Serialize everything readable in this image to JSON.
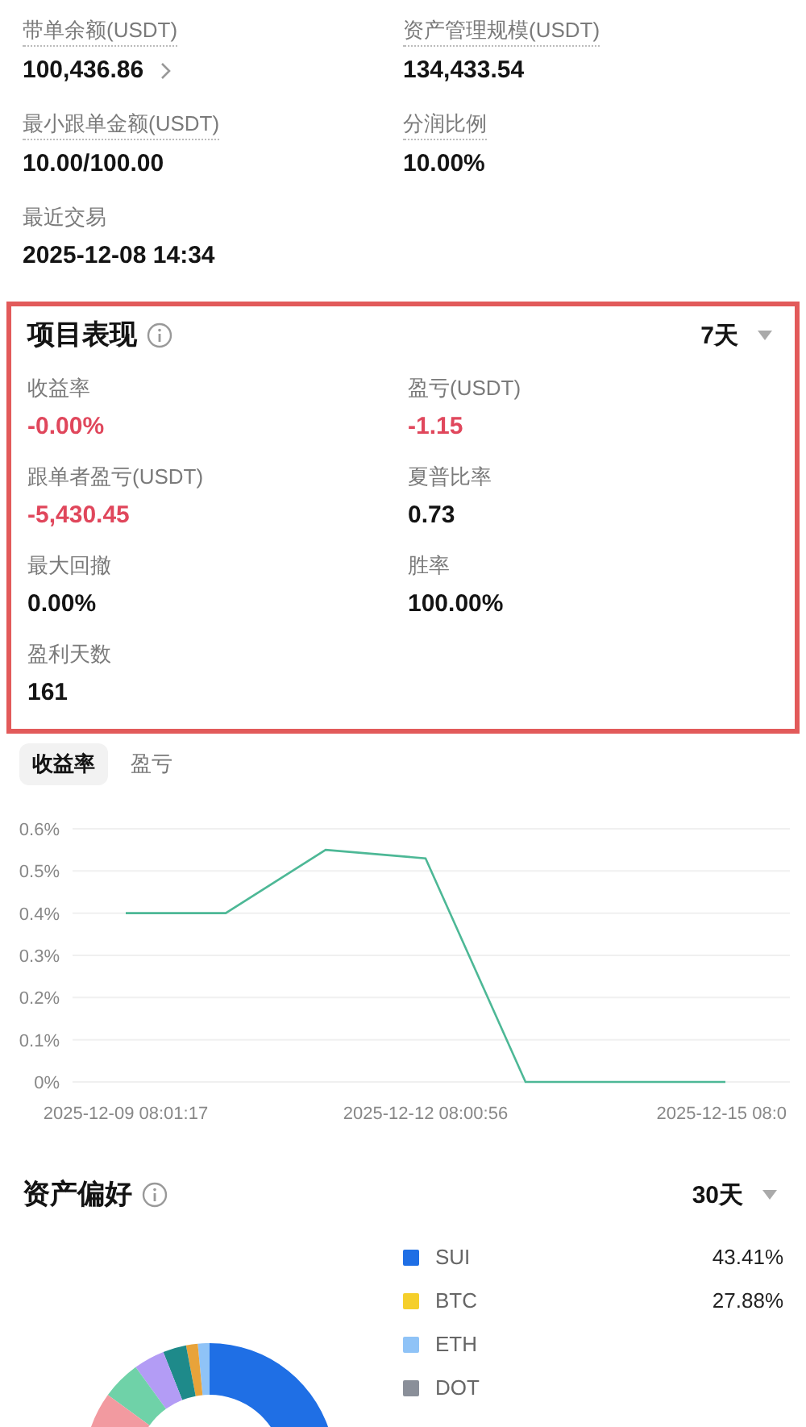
{
  "summary": {
    "items": [
      {
        "label": "带单余额(USDT)",
        "value": "100,436.86",
        "has_tooltip": true,
        "kind": "link"
      },
      {
        "label": "资产管理规模(USDT)",
        "value": "134,433.54",
        "has_tooltip": true,
        "kind": "plain"
      },
      {
        "label": "最小跟单金额(USDT)",
        "value": "10.00/100.00",
        "has_tooltip": true,
        "kind": "plain"
      },
      {
        "label": "分润比例",
        "value": "10.00%",
        "has_tooltip": true,
        "kind": "plain"
      },
      {
        "label": "最近交易",
        "value": "2025-12-08 14:34",
        "has_tooltip": false,
        "kind": "plain"
      }
    ]
  },
  "performance": {
    "title": "项目表现",
    "period": "7天",
    "highlighted": true,
    "metrics": [
      {
        "label": "收益率",
        "value": "-0.00%",
        "negative": true
      },
      {
        "label": "盈亏(USDT)",
        "value": "-1.15",
        "negative": true
      },
      {
        "label": "跟单者盈亏(USDT)",
        "value": "-5,430.45",
        "negative": true
      },
      {
        "label": "夏普比率",
        "value": "0.73",
        "negative": false
      },
      {
        "label": "最大回撤",
        "value": "0.00%",
        "negative": false
      },
      {
        "label": "胜率",
        "value": "100.00%",
        "negative": false
      },
      {
        "label": "盈利天数",
        "value": "161",
        "negative": false
      }
    ]
  },
  "chart_tabs": [
    {
      "label": "收益率",
      "selected": true
    },
    {
      "label": "盈亏",
      "selected": false
    }
  ],
  "chart": {
    "chart_data": {
      "type": "line",
      "categories": [
        "2025-12-09 08:01:17",
        null,
        null,
        "2025-12-12 08:00:56",
        null,
        null,
        "2025-12-15 08:0"
      ],
      "series": [
        {
          "color": "#4db896",
          "values": [
            0.4,
            0.4,
            0.55,
            0.53,
            0,
            0,
            0
          ]
        }
      ],
      "ylim": [
        0,
        0.6
      ],
      "grid": true,
      "yticks": [
        {
          "value": 0,
          "label": "0%"
        },
        {
          "value": 0.1,
          "label": "0.1%"
        },
        {
          "value": 0.2,
          "label": "0.2%"
        },
        {
          "value": 0.3,
          "label": "0.3%"
        },
        {
          "value": 0.4,
          "label": "0.4%"
        },
        {
          "value": 0.5,
          "label": "0.5%"
        },
        {
          "value": 0.6,
          "label": "0.6%"
        }
      ]
    }
  },
  "assets": {
    "title": "资产偏好",
    "period": "30天",
    "legend": [
      {
        "name": "SUI",
        "color": "#1f6fe5",
        "value": "43.41%"
      },
      {
        "name": "BTC",
        "color": "#f5cf2b",
        "value": "27.88%"
      },
      {
        "name": "ETH",
        "color": "#8fc3f7"
      },
      {
        "name": "DOT",
        "color": "#8a8f99"
      }
    ]
  }
}
